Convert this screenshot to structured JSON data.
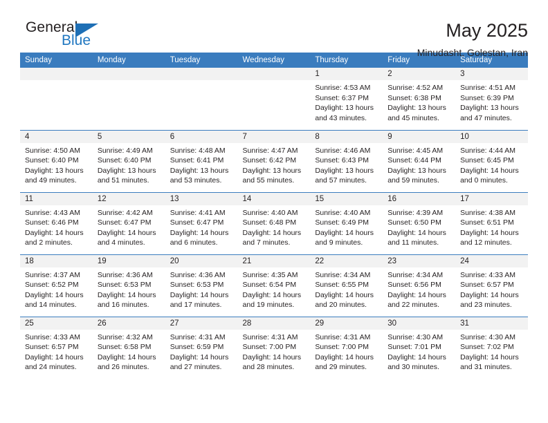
{
  "brand": {
    "name_part1": "General",
    "name_part2": "Blue",
    "triangle_color": "#1e6fb5",
    "blue_text_color": "#2077c0"
  },
  "header": {
    "title": "May 2025",
    "subtitle": "Minudasht, Golestan, Iran"
  },
  "calendar": {
    "header_bg": "#3a7cbe",
    "daynum_bg": "#f2f2f2",
    "weekday_headers": [
      "Sunday",
      "Monday",
      "Tuesday",
      "Wednesday",
      "Thursday",
      "Friday",
      "Saturday"
    ],
    "weeks": [
      [
        {
          "day": "",
          "sunrise": "",
          "sunset": "",
          "daylight_line1": "",
          "daylight_line2": ""
        },
        {
          "day": "",
          "sunrise": "",
          "sunset": "",
          "daylight_line1": "",
          "daylight_line2": ""
        },
        {
          "day": "",
          "sunrise": "",
          "sunset": "",
          "daylight_line1": "",
          "daylight_line2": ""
        },
        {
          "day": "",
          "sunrise": "",
          "sunset": "",
          "daylight_line1": "",
          "daylight_line2": ""
        },
        {
          "day": "1",
          "sunrise": "Sunrise: 4:53 AM",
          "sunset": "Sunset: 6:37 PM",
          "daylight_line1": "Daylight: 13 hours",
          "daylight_line2": "and 43 minutes."
        },
        {
          "day": "2",
          "sunrise": "Sunrise: 4:52 AM",
          "sunset": "Sunset: 6:38 PM",
          "daylight_line1": "Daylight: 13 hours",
          "daylight_line2": "and 45 minutes."
        },
        {
          "day": "3",
          "sunrise": "Sunrise: 4:51 AM",
          "sunset": "Sunset: 6:39 PM",
          "daylight_line1": "Daylight: 13 hours",
          "daylight_line2": "and 47 minutes."
        }
      ],
      [
        {
          "day": "4",
          "sunrise": "Sunrise: 4:50 AM",
          "sunset": "Sunset: 6:40 PM",
          "daylight_line1": "Daylight: 13 hours",
          "daylight_line2": "and 49 minutes."
        },
        {
          "day": "5",
          "sunrise": "Sunrise: 4:49 AM",
          "sunset": "Sunset: 6:40 PM",
          "daylight_line1": "Daylight: 13 hours",
          "daylight_line2": "and 51 minutes."
        },
        {
          "day": "6",
          "sunrise": "Sunrise: 4:48 AM",
          "sunset": "Sunset: 6:41 PM",
          "daylight_line1": "Daylight: 13 hours",
          "daylight_line2": "and 53 minutes."
        },
        {
          "day": "7",
          "sunrise": "Sunrise: 4:47 AM",
          "sunset": "Sunset: 6:42 PM",
          "daylight_line1": "Daylight: 13 hours",
          "daylight_line2": "and 55 minutes."
        },
        {
          "day": "8",
          "sunrise": "Sunrise: 4:46 AM",
          "sunset": "Sunset: 6:43 PM",
          "daylight_line1": "Daylight: 13 hours",
          "daylight_line2": "and 57 minutes."
        },
        {
          "day": "9",
          "sunrise": "Sunrise: 4:45 AM",
          "sunset": "Sunset: 6:44 PM",
          "daylight_line1": "Daylight: 13 hours",
          "daylight_line2": "and 59 minutes."
        },
        {
          "day": "10",
          "sunrise": "Sunrise: 4:44 AM",
          "sunset": "Sunset: 6:45 PM",
          "daylight_line1": "Daylight: 14 hours",
          "daylight_line2": "and 0 minutes."
        }
      ],
      [
        {
          "day": "11",
          "sunrise": "Sunrise: 4:43 AM",
          "sunset": "Sunset: 6:46 PM",
          "daylight_line1": "Daylight: 14 hours",
          "daylight_line2": "and 2 minutes."
        },
        {
          "day": "12",
          "sunrise": "Sunrise: 4:42 AM",
          "sunset": "Sunset: 6:47 PM",
          "daylight_line1": "Daylight: 14 hours",
          "daylight_line2": "and 4 minutes."
        },
        {
          "day": "13",
          "sunrise": "Sunrise: 4:41 AM",
          "sunset": "Sunset: 6:47 PM",
          "daylight_line1": "Daylight: 14 hours",
          "daylight_line2": "and 6 minutes."
        },
        {
          "day": "14",
          "sunrise": "Sunrise: 4:40 AM",
          "sunset": "Sunset: 6:48 PM",
          "daylight_line1": "Daylight: 14 hours",
          "daylight_line2": "and 7 minutes."
        },
        {
          "day": "15",
          "sunrise": "Sunrise: 4:40 AM",
          "sunset": "Sunset: 6:49 PM",
          "daylight_line1": "Daylight: 14 hours",
          "daylight_line2": "and 9 minutes."
        },
        {
          "day": "16",
          "sunrise": "Sunrise: 4:39 AM",
          "sunset": "Sunset: 6:50 PM",
          "daylight_line1": "Daylight: 14 hours",
          "daylight_line2": "and 11 minutes."
        },
        {
          "day": "17",
          "sunrise": "Sunrise: 4:38 AM",
          "sunset": "Sunset: 6:51 PM",
          "daylight_line1": "Daylight: 14 hours",
          "daylight_line2": "and 12 minutes."
        }
      ],
      [
        {
          "day": "18",
          "sunrise": "Sunrise: 4:37 AM",
          "sunset": "Sunset: 6:52 PM",
          "daylight_line1": "Daylight: 14 hours",
          "daylight_line2": "and 14 minutes."
        },
        {
          "day": "19",
          "sunrise": "Sunrise: 4:36 AM",
          "sunset": "Sunset: 6:53 PM",
          "daylight_line1": "Daylight: 14 hours",
          "daylight_line2": "and 16 minutes."
        },
        {
          "day": "20",
          "sunrise": "Sunrise: 4:36 AM",
          "sunset": "Sunset: 6:53 PM",
          "daylight_line1": "Daylight: 14 hours",
          "daylight_line2": "and 17 minutes."
        },
        {
          "day": "21",
          "sunrise": "Sunrise: 4:35 AM",
          "sunset": "Sunset: 6:54 PM",
          "daylight_line1": "Daylight: 14 hours",
          "daylight_line2": "and 19 minutes."
        },
        {
          "day": "22",
          "sunrise": "Sunrise: 4:34 AM",
          "sunset": "Sunset: 6:55 PM",
          "daylight_line1": "Daylight: 14 hours",
          "daylight_line2": "and 20 minutes."
        },
        {
          "day": "23",
          "sunrise": "Sunrise: 4:34 AM",
          "sunset": "Sunset: 6:56 PM",
          "daylight_line1": "Daylight: 14 hours",
          "daylight_line2": "and 22 minutes."
        },
        {
          "day": "24",
          "sunrise": "Sunrise: 4:33 AM",
          "sunset": "Sunset: 6:57 PM",
          "daylight_line1": "Daylight: 14 hours",
          "daylight_line2": "and 23 minutes."
        }
      ],
      [
        {
          "day": "25",
          "sunrise": "Sunrise: 4:33 AM",
          "sunset": "Sunset: 6:57 PM",
          "daylight_line1": "Daylight: 14 hours",
          "daylight_line2": "and 24 minutes."
        },
        {
          "day": "26",
          "sunrise": "Sunrise: 4:32 AM",
          "sunset": "Sunset: 6:58 PM",
          "daylight_line1": "Daylight: 14 hours",
          "daylight_line2": "and 26 minutes."
        },
        {
          "day": "27",
          "sunrise": "Sunrise: 4:31 AM",
          "sunset": "Sunset: 6:59 PM",
          "daylight_line1": "Daylight: 14 hours",
          "daylight_line2": "and 27 minutes."
        },
        {
          "day": "28",
          "sunrise": "Sunrise: 4:31 AM",
          "sunset": "Sunset: 7:00 PM",
          "daylight_line1": "Daylight: 14 hours",
          "daylight_line2": "and 28 minutes."
        },
        {
          "day": "29",
          "sunrise": "Sunrise: 4:31 AM",
          "sunset": "Sunset: 7:00 PM",
          "daylight_line1": "Daylight: 14 hours",
          "daylight_line2": "and 29 minutes."
        },
        {
          "day": "30",
          "sunrise": "Sunrise: 4:30 AM",
          "sunset": "Sunset: 7:01 PM",
          "daylight_line1": "Daylight: 14 hours",
          "daylight_line2": "and 30 minutes."
        },
        {
          "day": "31",
          "sunrise": "Sunrise: 4:30 AM",
          "sunset": "Sunset: 7:02 PM",
          "daylight_line1": "Daylight: 14 hours",
          "daylight_line2": "and 31 minutes."
        }
      ]
    ]
  }
}
